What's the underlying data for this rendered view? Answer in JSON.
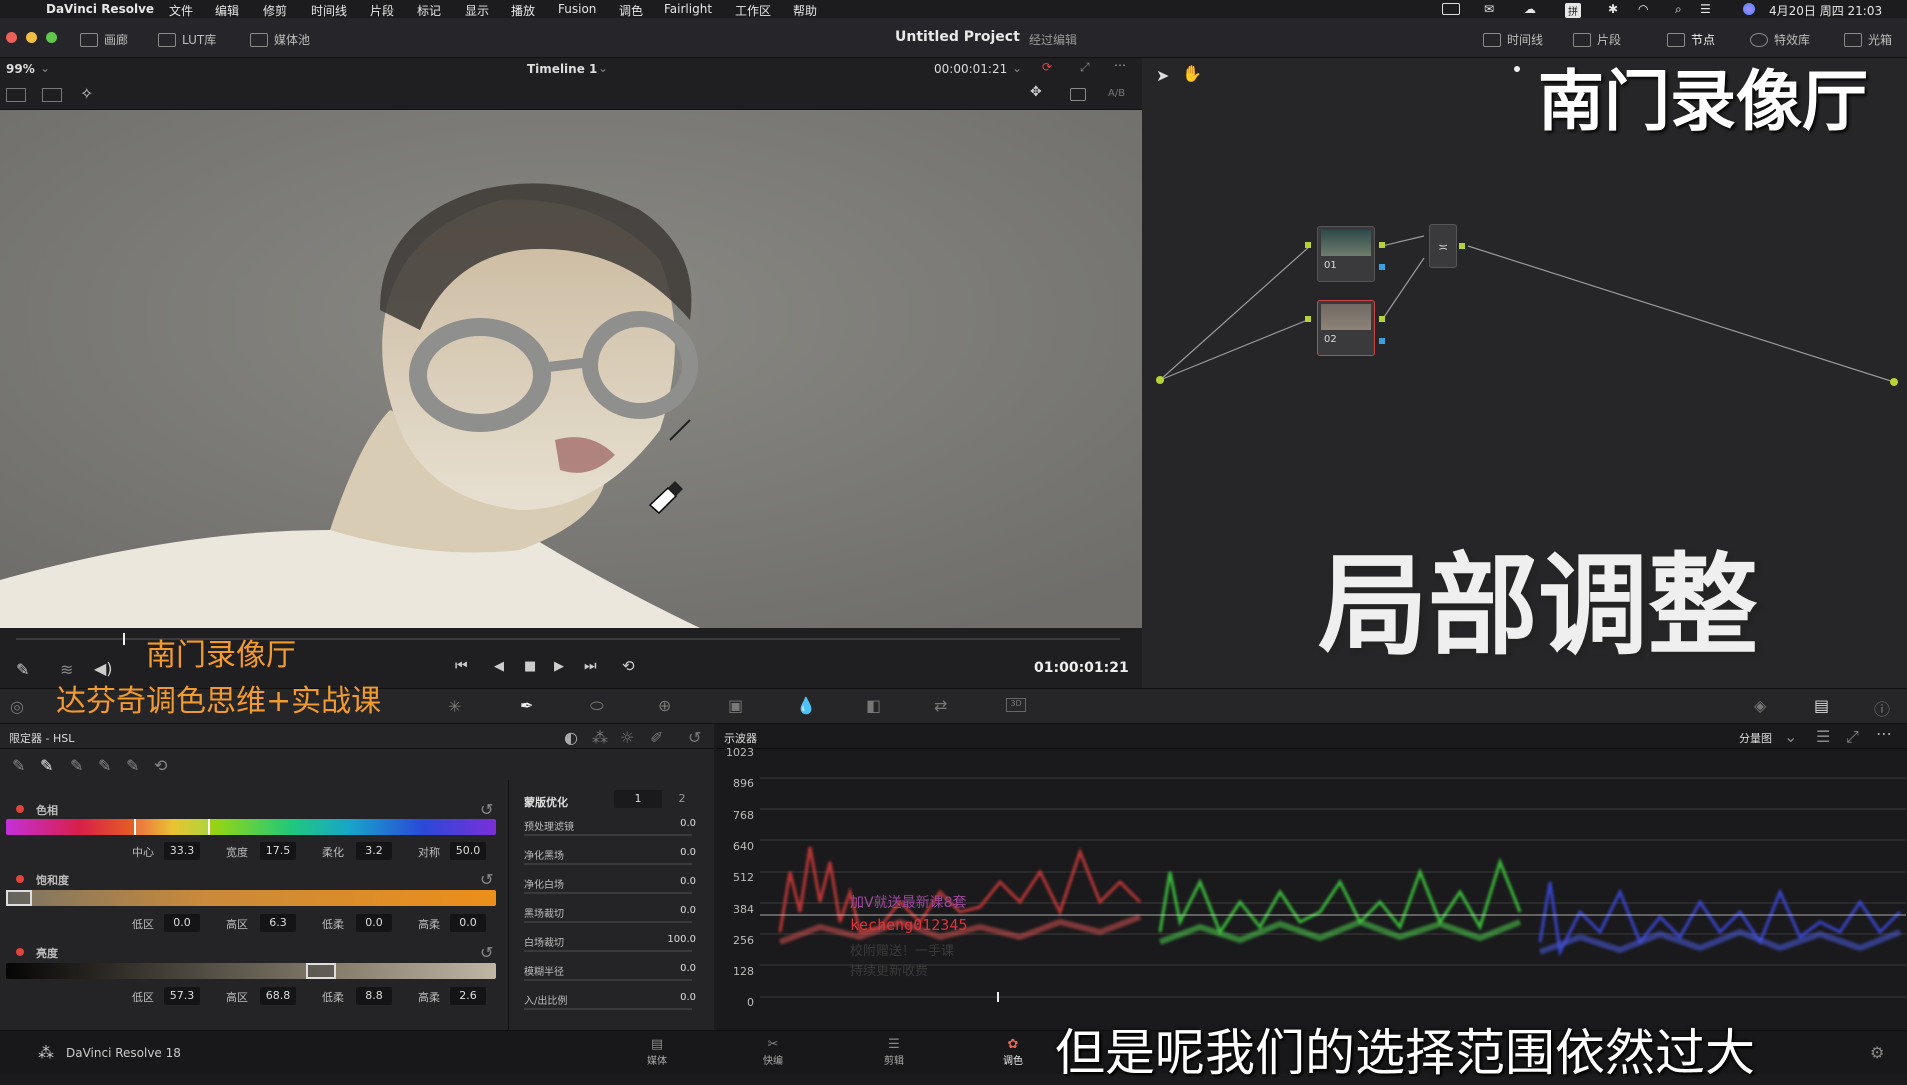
{
  "menubar": {
    "app_name": "DaVinci Resolve",
    "menus": [
      "文件",
      "编辑",
      "修剪",
      "时间线",
      "片段",
      "标记",
      "显示",
      "播放",
      "Fusion",
      "调色",
      "Fairlight",
      "工作区",
      "帮助"
    ],
    "clock": "4月20日 周四  21:03",
    "input_method": "拼"
  },
  "toolbar": {
    "gallery": "画廊",
    "lut": "LUT库",
    "media_pool": "媒体池",
    "project_title": "Untitled Project",
    "project_status": "经过编辑",
    "timeline": "时间线",
    "clips": "片段",
    "nodes": "节点",
    "effects": "特效库",
    "lightbox": "光箱"
  },
  "viewer": {
    "zoom": "99%",
    "timeline_name": "Timeline 1",
    "timecode_top": "00:00:01:21",
    "ab_label": "A/B",
    "timecode": "01:00:01:21"
  },
  "nodes": [
    {
      "label": "01"
    },
    {
      "label": "02"
    }
  ],
  "overlays": {
    "watermark_top": "南门录像厅",
    "big_title": "局部调整",
    "brand_small": "南门录像厅",
    "course_title": "达芬奇调色思维+实战课",
    "subtitle": "但是呢我们的选择范围依然过大",
    "promo_line1": "加V就送最新课8套",
    "promo_line2": "kecheng012345",
    "promo_line3": "校附赠送！一手课",
    "promo_line4": "持续更新收费"
  },
  "qualifier": {
    "title": "限定器 - HSL",
    "hue": {
      "label": "色相",
      "fields": [
        {
          "name": "中心",
          "value": "33.3"
        },
        {
          "name": "宽度",
          "value": "17.5"
        },
        {
          "name": "柔化",
          "value": "3.2"
        },
        {
          "name": "对称",
          "value": "50.0"
        }
      ]
    },
    "sat": {
      "label": "饱和度",
      "fields": [
        {
          "name": "低区",
          "value": "0.0"
        },
        {
          "name": "高区",
          "value": "6.3"
        },
        {
          "name": "低柔",
          "value": "0.0"
        },
        {
          "name": "高柔",
          "value": "0.0"
        }
      ]
    },
    "lum": {
      "label": "亮度",
      "fields": [
        {
          "name": "低区",
          "value": "57.3"
        },
        {
          "name": "高区",
          "value": "68.8"
        },
        {
          "name": "低柔",
          "value": "8.8"
        },
        {
          "name": "高柔",
          "value": "2.6"
        }
      ]
    },
    "matte": {
      "title": "蒙版优化",
      "tab1": "1",
      "tab2": "2",
      "rows": [
        {
          "name": "预处理滤镜",
          "value": "0.0"
        },
        {
          "name": "净化黑场",
          "value": "0.0"
        },
        {
          "name": "净化白场",
          "value": "0.0"
        },
        {
          "name": "黑场裁切",
          "value": "0.0"
        },
        {
          "name": "白场裁切",
          "value": "100.0"
        },
        {
          "name": "模糊半径",
          "value": "0.0"
        },
        {
          "name": "入/出比例",
          "value": "0.0"
        }
      ]
    }
  },
  "scope": {
    "title": "示波器",
    "mode": "分量图",
    "ticks": [
      "1023",
      "896",
      "768",
      "640",
      "512",
      "384",
      "256",
      "128",
      "0"
    ]
  },
  "pages": {
    "version": "DaVinci Resolve 18",
    "media": "媒体",
    "cut": "快编",
    "edit": "剪辑",
    "color": "调色"
  }
}
